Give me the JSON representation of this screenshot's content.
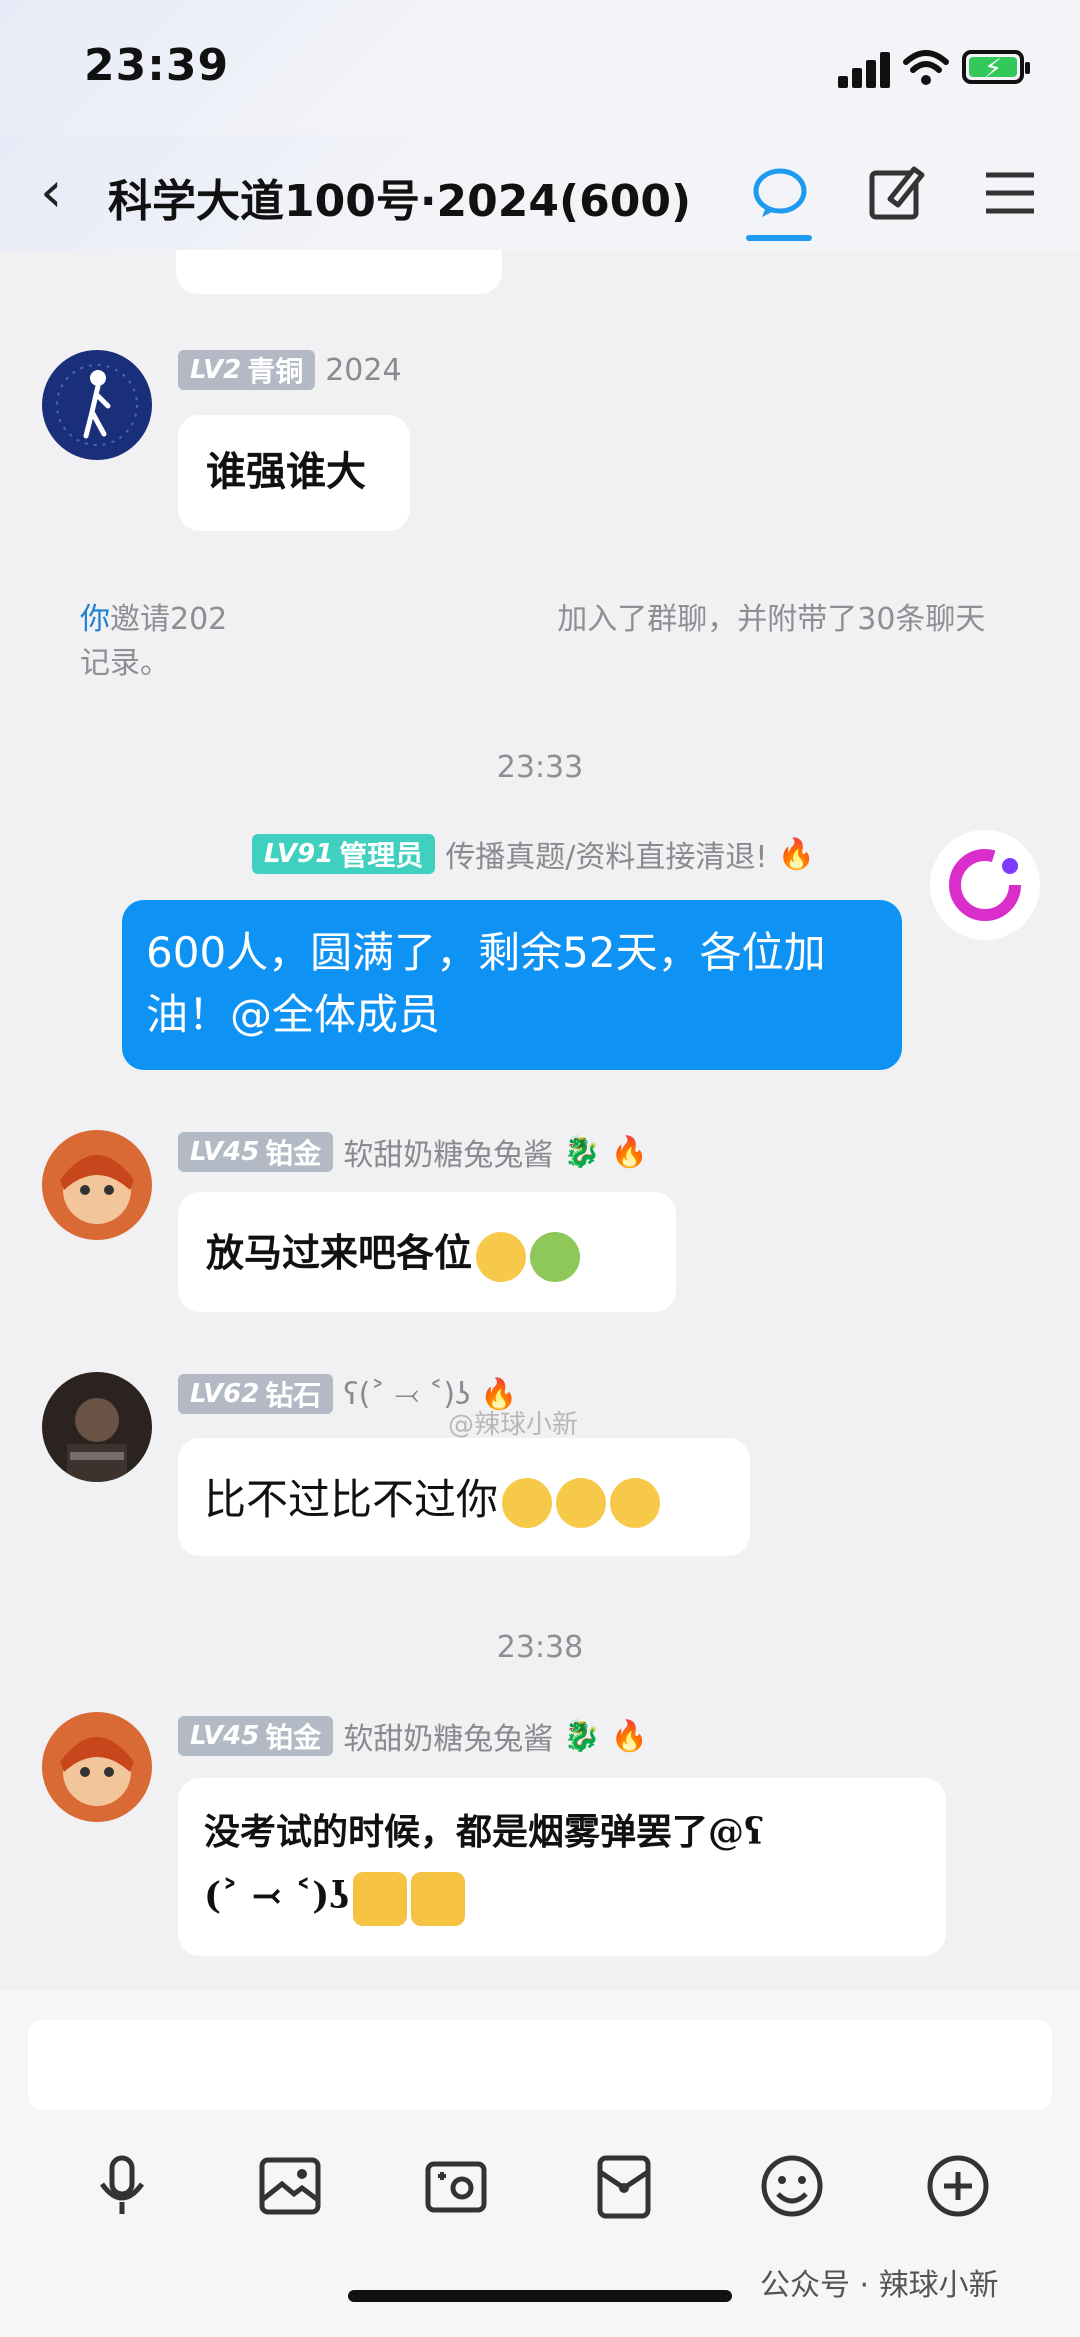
{
  "status_bar": {
    "time": "23:39"
  },
  "header": {
    "title": "科学大道100号·2024(600)"
  },
  "messages": [
    {
      "badge_lv": "LV2",
      "badge_rank": "青铜",
      "nick": "2024",
      "text": "谁强谁大"
    },
    {
      "badge_lv": "LV91",
      "badge_rank": "管理员",
      "nick": "传播真题/资料直接清退!",
      "text": "600人，圆满了，剩余52天，各位加油！@全体成员"
    },
    {
      "badge_lv": "LV45",
      "badge_rank": "铂金",
      "nick": "软甜奶糖兔兔酱",
      "text": "放马过来吧各位"
    },
    {
      "badge_lv": "LV62",
      "badge_rank": "钻石",
      "nick": "ʕ(˃ ⤙ ˂)ʖ",
      "text": "比不过比不过你"
    },
    {
      "badge_lv": "LV45",
      "badge_rank": "铂金",
      "nick": "软甜奶糖兔兔酱",
      "text_line1": "没考试的时候，都是烟雾弹罢了@ʕ",
      "text_line2": "(˃ ⤙ ˂)ʖ"
    }
  ],
  "system_notice": {
    "you": "你",
    "text": "邀请202　　　　　　　　　　　加入了群聊，并附带了30条聊天记录。"
  },
  "timestamps": [
    "23:33",
    "23:38"
  ],
  "watermark": "@辣球小新",
  "footer_watermark": "公众号 · 辣球小新",
  "colors": {
    "accent": "#1e9bf0",
    "my_bubble": "#0e93f5",
    "admin_badge": "#3fd0c0",
    "badge": "#b4b9c6"
  },
  "icons": [
    "back-icon",
    "chat-icon",
    "edit-icon",
    "menu-icon",
    "mic-icon",
    "image-icon",
    "camera-icon",
    "red-packet-icon",
    "emoji-icon",
    "plus-icon"
  ]
}
